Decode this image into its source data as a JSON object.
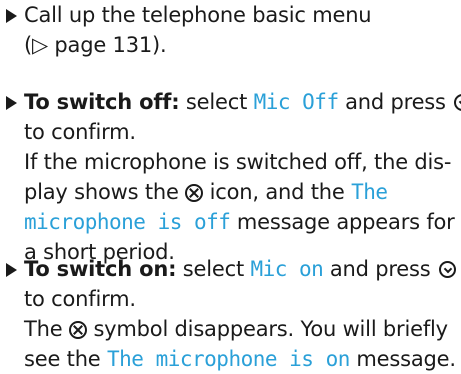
{
  "steps": [
    {
      "line1": "Call up the telephone basic menu",
      "line2": "(▷ page 131)."
    },
    {
      "bold_label": "To switch off:",
      "select_text": "select",
      "option": "Mic Off",
      "press_text": "and press",
      "confirm_text": "to confirm.",
      "detail_1": "If the microphone is switched off, the dis-",
      "detail_2a": "play shows the",
      "detail_2b": "icon, and the",
      "msg_1": "The",
      "msg_2": "microphone is off",
      "detail_3": "message appears for",
      "detail_4": "a short period."
    },
    {
      "bold_label": "To switch on:",
      "select_text": "select",
      "option": "Mic on",
      "press_text": "and press",
      "confirm_text": "to confirm.",
      "detail_1a": "The",
      "detail_1b": "symbol disappears. You will briefly",
      "detail_2a": "see the",
      "msg": "The microphone is on",
      "detail_2b": "message."
    }
  ],
  "icons": {
    "bullet": "bullet-arrow-icon",
    "confirm_button": "controller-press-icon",
    "mic_off": "mic-off-icon"
  }
}
